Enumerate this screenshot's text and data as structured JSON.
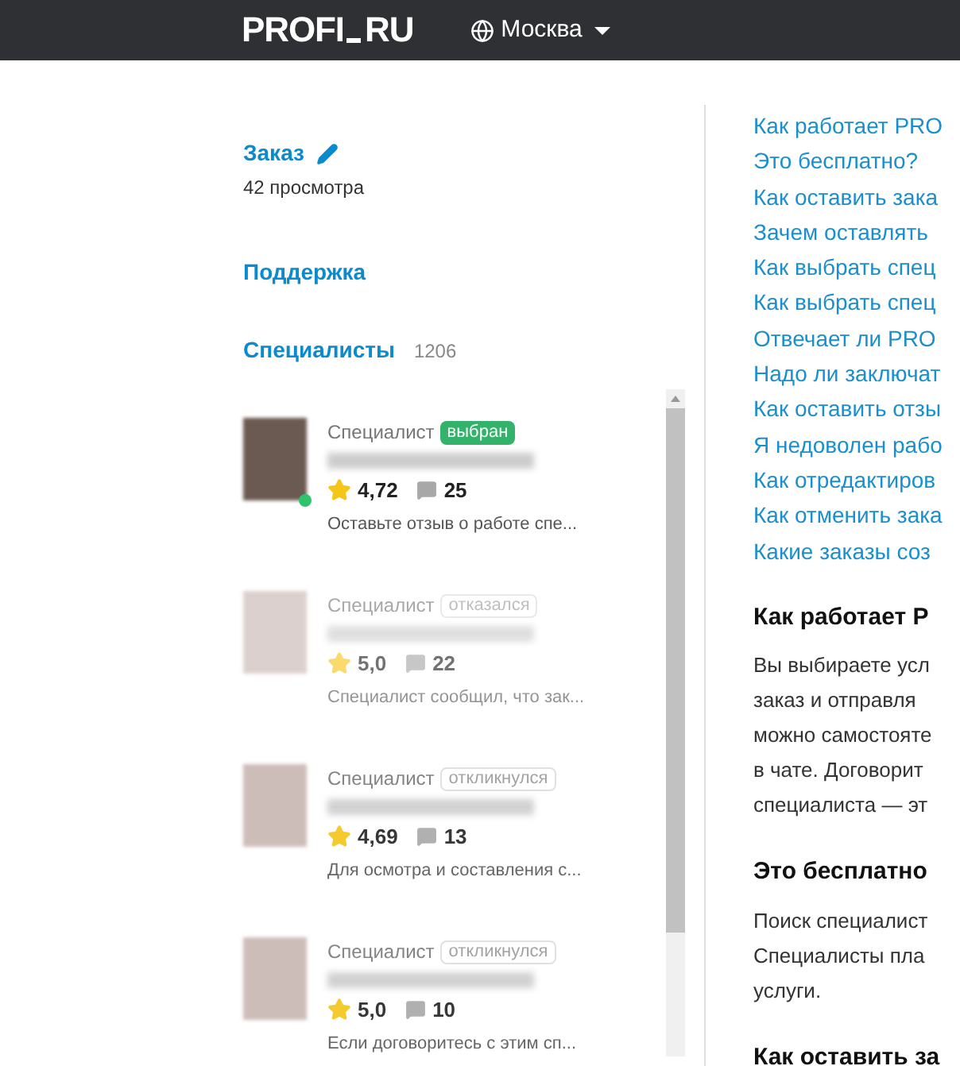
{
  "header": {
    "logo": "PROFI",
    "logo_suffix": "RU",
    "city": "Москва"
  },
  "order": {
    "title": "Заказ",
    "views": "42 просмотра"
  },
  "support": {
    "title": "Поддержка"
  },
  "specialists": {
    "title": "Специалисты",
    "count": "1206",
    "items": [
      {
        "role": "Специалист",
        "status": "выбран",
        "kind": "chosen",
        "faded": false,
        "online": true,
        "rating": "4,72",
        "reviews": "25",
        "note": "Оставьте отзыв о работе спе..."
      },
      {
        "role": "Специалист",
        "status": "отказался",
        "kind": "other",
        "faded": true,
        "online": false,
        "rating": "5,0",
        "reviews": "22",
        "note": "Специалист сообщил, что зак..."
      },
      {
        "role": "Специалист",
        "status": "откликнулся",
        "kind": "other",
        "faded": false,
        "online": false,
        "rating": "4,69",
        "reviews": "13",
        "note": "Для осмотра и составления с..."
      },
      {
        "role": "Специалист",
        "status": "откликнулся",
        "kind": "other",
        "faded": false,
        "online": false,
        "rating": "5,0",
        "reviews": "10",
        "note": "Если договоритесь с этим сп..."
      }
    ]
  },
  "faq_links": [
    "Как работает PRO",
    "Это бесплатно?",
    "Как оставить зака",
    "Зачем оставлять",
    "Как выбрать спец",
    "Как выбрать спец",
    "Отвечает ли PRO",
    "Надо ли заключат",
    "Как оставить отзы",
    "Я недоволен рабо",
    "Как отредактиров",
    "Как отменить зака",
    "Какие заказы соз"
  ],
  "faq_sections": [
    {
      "title": "Как работает P",
      "lines": [
        "Вы выбираете усл",
        "заказ и отправля",
        "можно самостояте",
        "в чате. Договорит",
        "специалиста — эт"
      ]
    },
    {
      "title": "Это бесплатно",
      "lines": [
        "Поиск специалист",
        "Специалисты пла",
        "услуги."
      ]
    },
    {
      "title": "Как оставить за"
    }
  ]
}
